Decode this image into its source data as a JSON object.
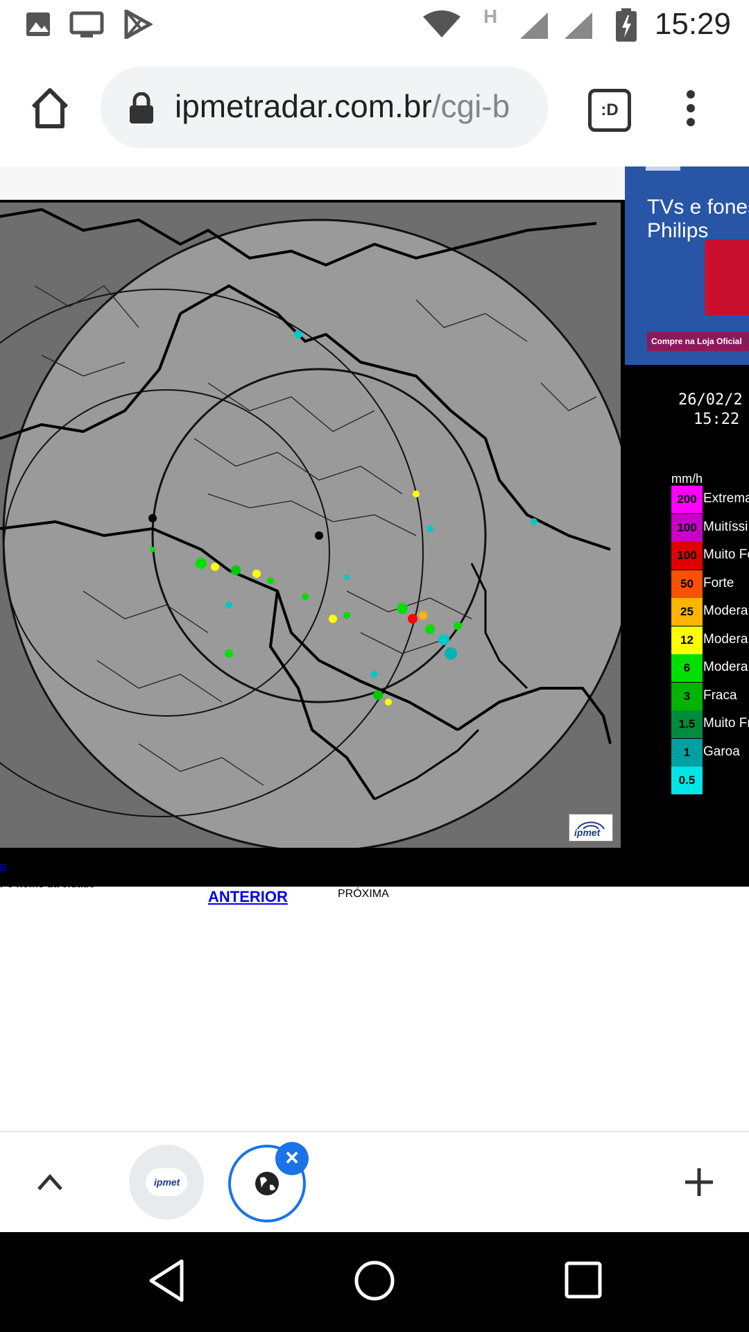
{
  "status_bar": {
    "time": "15:29",
    "network_label": "H",
    "icons": [
      "image-icon",
      "cast-icon",
      "play-store-icon",
      "wifi-icon",
      "signal-icon",
      "battery-charging-icon"
    ]
  },
  "browser": {
    "url_domain": "ipmetradar.com.br",
    "url_path": "/cgi-b",
    "tab_switcher_label": ":D"
  },
  "ad": {
    "title": "TVs e fones Philips",
    "cta": "Compre na Loja Oficial",
    "accent_color": "#2855a6"
  },
  "radar": {
    "date": "26/02/2",
    "time": "15:22",
    "watermark": "ipmet",
    "legend_unit": "mm/h",
    "legend": [
      {
        "value": "200",
        "label": "Extrema",
        "color": "#ff00ff"
      },
      {
        "value": "100",
        "label": "Muitíssi",
        "color": "#c800c8"
      },
      {
        "value": "100",
        "label": "Muito Fo",
        "color": "#e00000"
      },
      {
        "value": "50",
        "label": "Forte",
        "color": "#ff5000"
      },
      {
        "value": "25",
        "label": "Modera",
        "color": "#ffb400"
      },
      {
        "value": "12",
        "label": "Modera",
        "color": "#ffff00"
      },
      {
        "value": "6",
        "label": "Modera",
        "color": "#00e000"
      },
      {
        "value": "3",
        "label": "Fraca",
        "color": "#00b400"
      },
      {
        "value": "1.5",
        "label": "Muito Fr",
        "color": "#008c3c"
      },
      {
        "value": "1",
        "label": "Garoa",
        "color": "#00a0a0"
      },
      {
        "value": "0.5",
        "label": "",
        "color": "#00e6e6"
      }
    ]
  },
  "page_text": {
    "link_fragment": "o",
    "city_prompt": "r o nome da cidade",
    "prev_label": "ANTERIOR",
    "next_label": "PRÓXIMA"
  },
  "tabs": {
    "tab1_logo": "ipmet"
  }
}
